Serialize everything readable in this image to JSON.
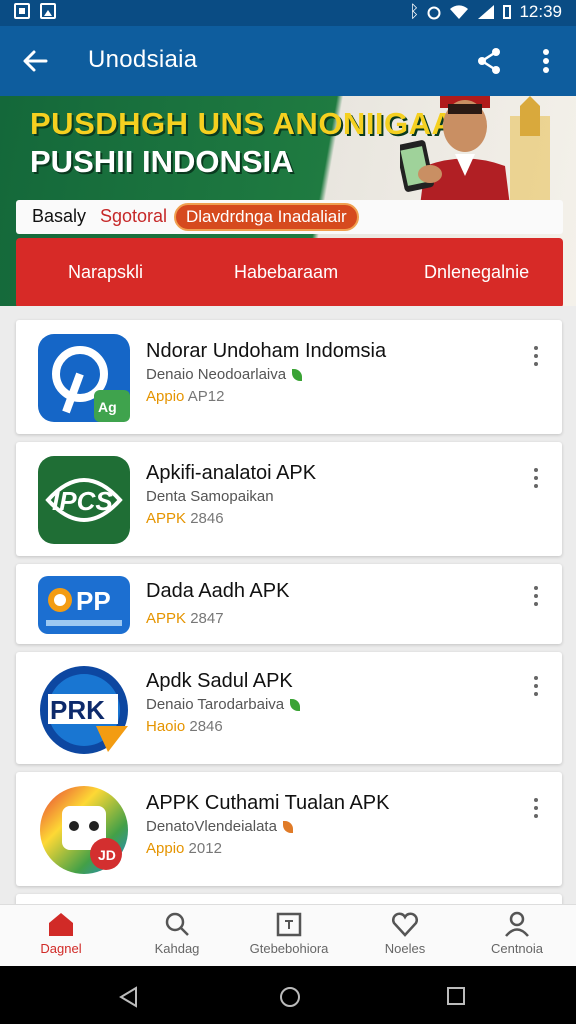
{
  "status_bar": {
    "time": "12:39"
  },
  "app_bar": {
    "title": "Unodsiaia"
  },
  "banner": {
    "headline_1": "PUSDHGH UNS ANONIIGAA",
    "headline_2": "PUSHII INDONSIA",
    "sub_label_1": "Basaly",
    "sub_label_2": "Sgotoral",
    "sub_chip": "Dlavdrdnga Inadaliair",
    "tabs": [
      "Narapskli",
      "Habebaraam",
      "Dnlenegalnie"
    ]
  },
  "apps": [
    {
      "name": "Ndorar Undoham Indomsia",
      "developer": "Denaio Neodoarlaiva",
      "meta_prefix": "Appio",
      "meta": "AP12",
      "badge": "green",
      "icon": "app-icon-blue-p"
    },
    {
      "name": "Apkifi-analatoi APK",
      "developer": "Denta Samopaikan",
      "meta_prefix": "APPK",
      "meta": "2846",
      "badge": "",
      "icon": "app-icon-green-ipcs"
    },
    {
      "name": "Dada Aadh APK",
      "developer": "",
      "meta_prefix": "APPK",
      "meta": "2847",
      "badge": "",
      "icon": "app-icon-pp"
    },
    {
      "name": "Apdk Sadul APK",
      "developer": "Denaio Tarodarbaiva",
      "meta_prefix": "Haoio",
      "meta": "2846",
      "badge": "green",
      "icon": "app-icon-prk"
    },
    {
      "name": "APPK Cuthami Tualan APK",
      "developer": "DenatoVlendeialata",
      "meta_prefix": "Appio",
      "meta": "2012",
      "badge": "orange",
      "icon": "app-icon-robot"
    }
  ],
  "bottom_nav": [
    {
      "label": "Dagnel",
      "icon": "home-icon",
      "active": true
    },
    {
      "label": "Kahdag",
      "icon": "search-icon",
      "active": false
    },
    {
      "label": "Gtebebohiora",
      "icon": "calendar-icon",
      "active": false
    },
    {
      "label": "Noeles",
      "icon": "heart-icon",
      "active": false
    },
    {
      "label": "Centnoia",
      "icon": "person-icon",
      "active": false
    }
  ],
  "colors": {
    "app_bar": "#0e5d9e",
    "status_bar": "#0a4c84",
    "accent_red": "#d72a27",
    "banner_green": "#1f7b41",
    "banner_yellow": "#f5d020"
  }
}
